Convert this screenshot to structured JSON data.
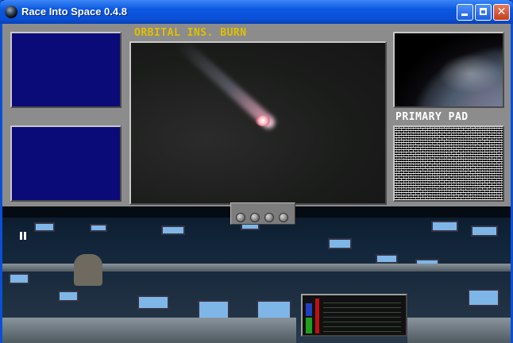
{
  "window": {
    "title": "Race Into Space 0.4.8",
    "controls": {
      "close_glyph": "✕"
    }
  },
  "console": {
    "main_screen_label": "ORBITAL INS. BURN",
    "pad_label": "PRIMARY PAD"
  },
  "colors": {
    "titlebar": "#0a4fd6",
    "console_gray": "#8c8c8c",
    "monitor_blue": "#0a0a78",
    "label_yellow": "#e0c000",
    "label_white": "#ffffff"
  },
  "icons": [
    "app-icon",
    "minimize-icon",
    "maximize-icon",
    "close-icon",
    "pause-icon"
  ]
}
